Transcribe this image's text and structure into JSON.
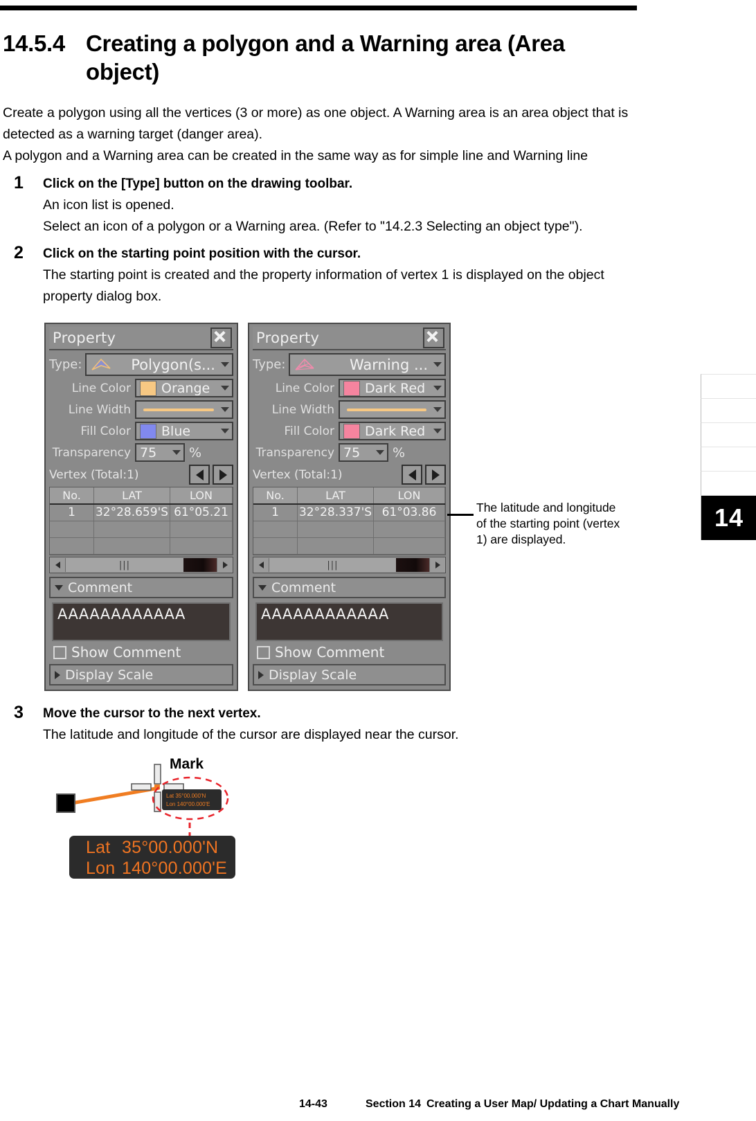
{
  "page": {
    "section_number": "14.5.4",
    "section_title": "Creating a polygon and a Warning area (Area object)",
    "side_tab_current": "14"
  },
  "intro": {
    "line1": "Create a polygon using all the vertices (3 or more) as one object. A Warning area is an area object that is detected as a warning target (danger area).",
    "line2": "A polygon and a Warning area can be created in the same way as for simple line and Warning line"
  },
  "steps": [
    {
      "number": "1",
      "lead": "Click on the [Type] button on the drawing toolbar.",
      "line1": "An icon list is opened.",
      "line2": "Select an icon of a polygon or a Warning area. (Refer to \"14.2.3 Selecting an object type\")."
    },
    {
      "number": "2",
      "lead": "Click on the starting point position with the cursor.",
      "line1": "The starting point is created and the property information of vertex 1 is displayed on the object property dialog box.",
      "line2": ""
    },
    {
      "number": "3",
      "lead": "Move the cursor to the next vertex.",
      "line1": "The latitude and longitude of the cursor are displayed near the cursor.",
      "line2": ""
    }
  ],
  "dialog_polygon": {
    "title": "Property",
    "close_label": "×",
    "type_label": "Type:",
    "type_value": "Polygon(s...",
    "line_color_label": "Line Color",
    "line_color_value": "Orange",
    "line_color_hex": "#f7c883",
    "line_width_label": "Line Width",
    "line_width_hex": "#f7c883",
    "fill_color_label": "Fill Color",
    "fill_color_value": "Blue",
    "fill_color_hex": "#8189ef",
    "transparency_label": "Transparency",
    "transparency_value": "75",
    "transparency_unit": "%",
    "vertex_label": "Vertex  (Total:1)",
    "table": {
      "headers": [
        "No.",
        "LAT",
        "LON"
      ],
      "rows": [
        [
          "1",
          "32°28.659'S",
          "61°05.21"
        ],
        [
          "",
          "",
          ""
        ],
        [
          "",
          "",
          ""
        ]
      ]
    },
    "scrollbar_mark": "|||",
    "comment_section_label": "Comment",
    "comment_text": "AAAAAAAAAAAA",
    "show_comment_label": "Show Comment",
    "display_scale_label": "Display Scale"
  },
  "dialog_warning": {
    "title": "Property",
    "close_label": "×",
    "type_label": "Type:",
    "type_value": "Warning ...",
    "line_color_label": "Line Color",
    "line_color_value": "Dark Red",
    "line_color_hex": "#f5849f",
    "line_width_label": "Line Width",
    "line_width_hex": "#f7c883",
    "fill_color_label": "Fill Color",
    "fill_color_value": "Dark Red",
    "fill_color_hex": "#f5849f",
    "transparency_label": "Transparency",
    "transparency_value": "75",
    "transparency_unit": "%",
    "vertex_label": "Vertex  (Total:1)",
    "table": {
      "headers": [
        "No.",
        "LAT",
        "LON"
      ],
      "rows": [
        [
          "1",
          "32°28.337'S",
          "61°03.86"
        ],
        [
          "",
          "",
          ""
        ],
        [
          "",
          "",
          ""
        ]
      ]
    },
    "scrollbar_mark": "|||",
    "comment_section_label": "Comment",
    "comment_text": "AAAAAAAAAAAA",
    "show_comment_label": "Show Comment",
    "display_scale_label": "Display Scale"
  },
  "callout": {
    "text": "The latitude and longitude of the starting point (vertex 1) are displayed."
  },
  "figure": {
    "mark_label": "Mark",
    "small_lat": "Lat  35°00.000'N",
    "small_lon": "Lon 140°00.000'E",
    "big_lat_label": "Lat",
    "big_lat_value": "35°00.000'N",
    "big_lon_label": "Lon",
    "big_lon_value": "140°00.000'E",
    "accent_orange": "#f07d22",
    "accent_red": "#e8232a"
  },
  "footer": {
    "page_number": "14-43",
    "section": "Section 14",
    "title": "Creating a User Map/ Updating a Chart Manually"
  }
}
